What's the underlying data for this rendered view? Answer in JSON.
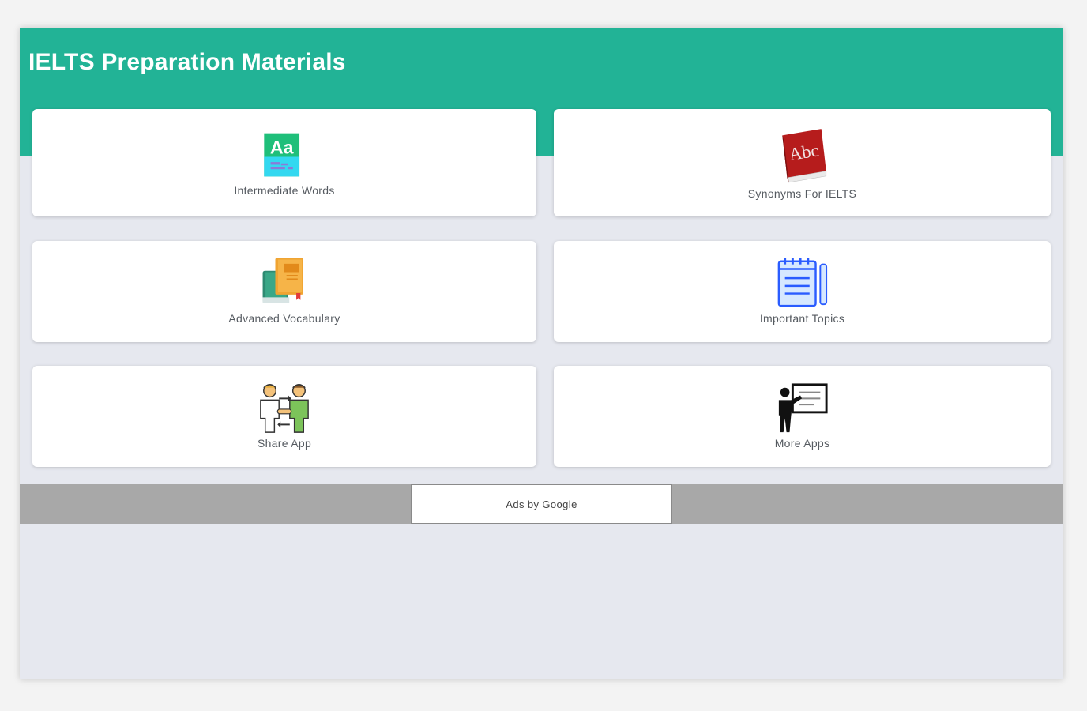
{
  "app": {
    "title": "IELTS Preparation Materials"
  },
  "menu": {
    "items": [
      {
        "label": "Intermediate Words",
        "icon": "dictionary-aa-icon"
      },
      {
        "label": "Synonyms For IELTS",
        "icon": "abc-book-icon"
      },
      {
        "label": "Advanced Vocabulary",
        "icon": "books-icon"
      },
      {
        "label": "Important Topics",
        "icon": "notepad-icon"
      },
      {
        "label": "Share App",
        "icon": "people-exchange-icon"
      },
      {
        "label": "More Apps",
        "icon": "presenter-board-icon"
      }
    ]
  },
  "ad": {
    "label": "Ads by Google"
  },
  "colors": {
    "header": "#22b396",
    "background": "#e6e8ef",
    "ad_bar": "#a8a8a8"
  }
}
